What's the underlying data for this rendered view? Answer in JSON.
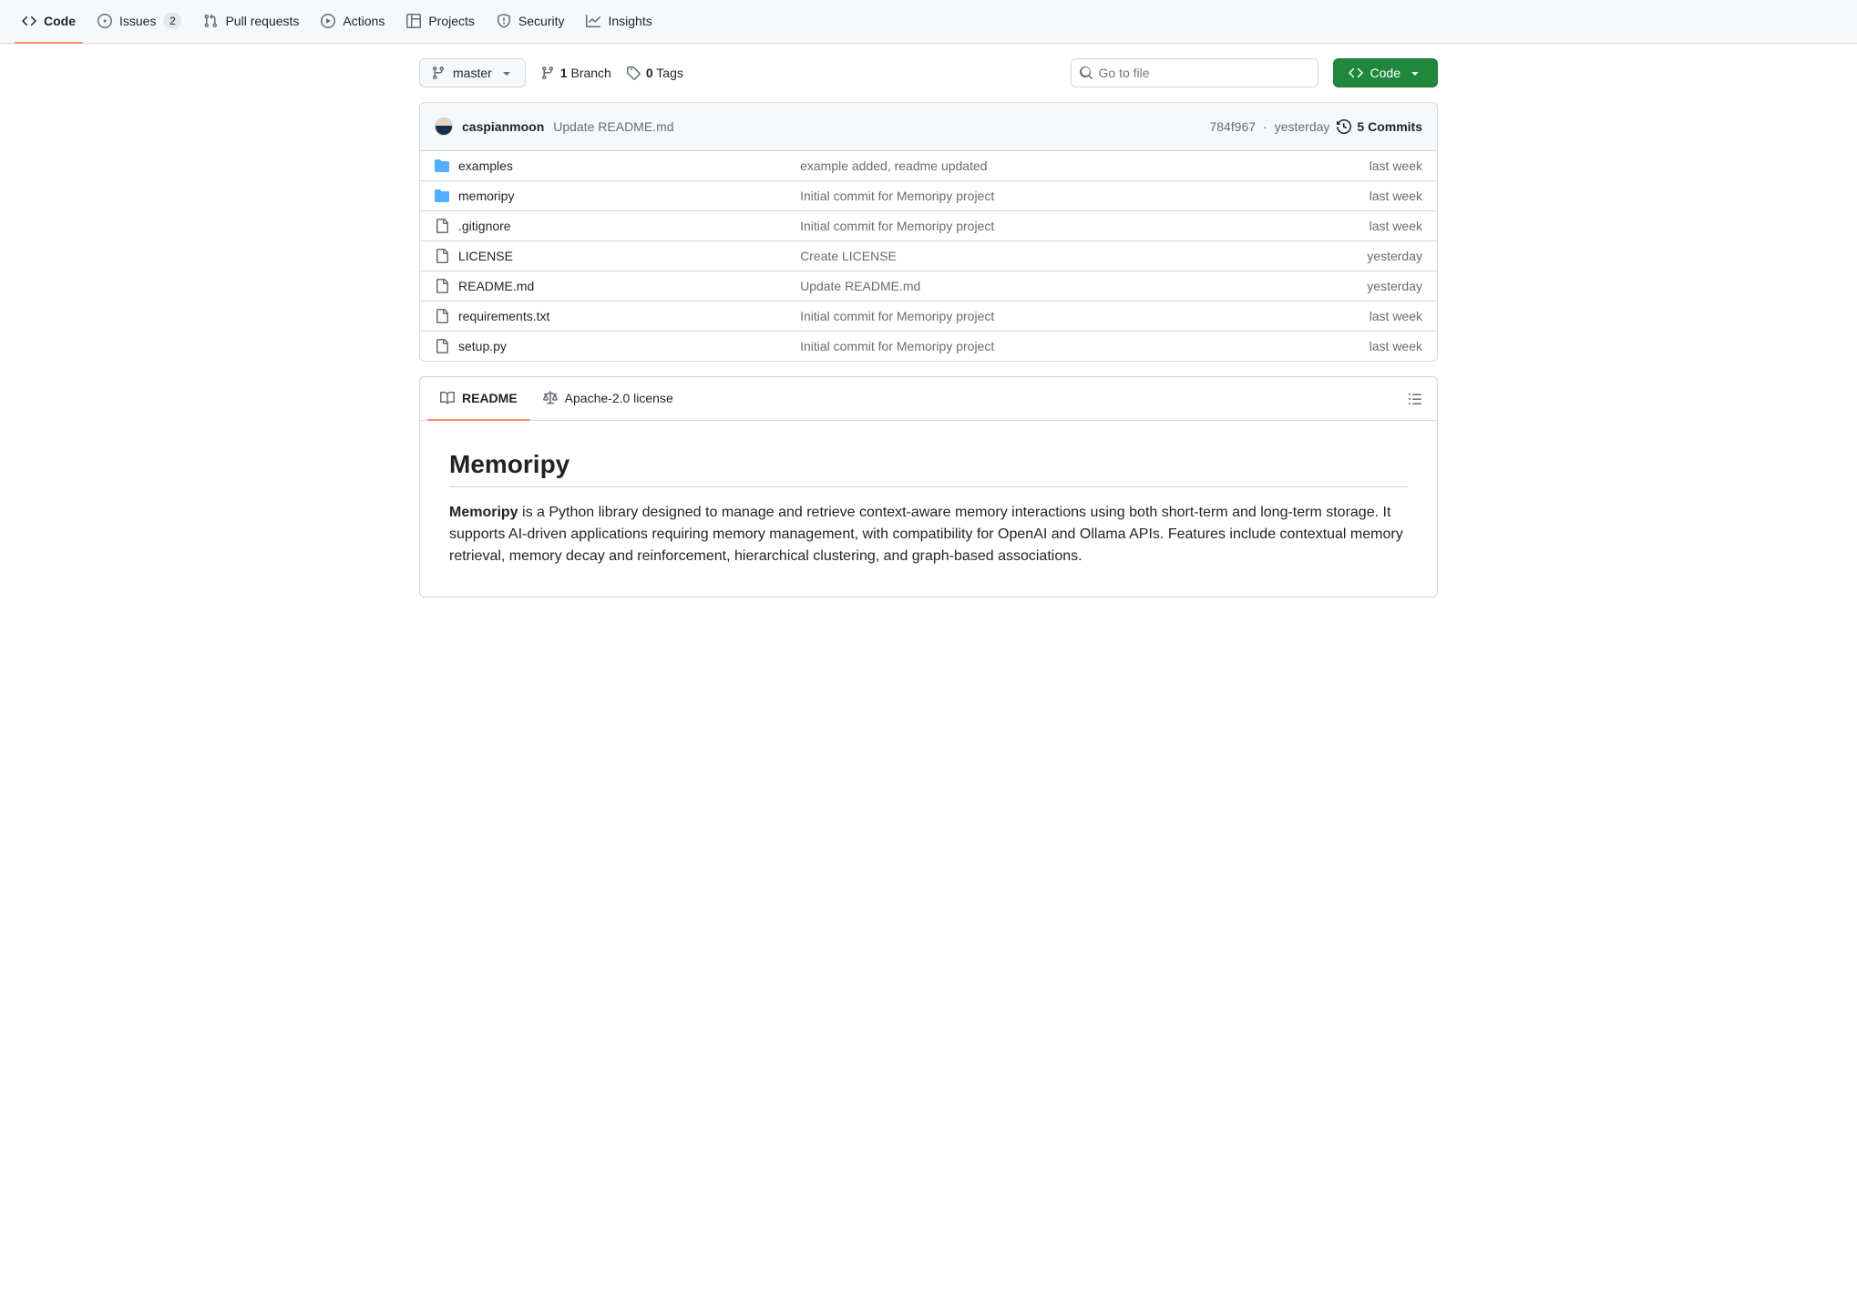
{
  "nav": {
    "code": "Code",
    "issues": "Issues",
    "issues_count": "2",
    "pulls": "Pull requests",
    "actions": "Actions",
    "projects": "Projects",
    "security": "Security",
    "insights": "Insights"
  },
  "toolbar": {
    "branch": "master",
    "branch_count": "1",
    "branch_label": "Branch",
    "tags_count": "0",
    "tags_label": "Tags",
    "search_placeholder": "Go to file",
    "code_label": "Code"
  },
  "commit": {
    "author": "caspianmoon",
    "message": "Update README.md",
    "sha": "784f967",
    "sep": "·",
    "when": "yesterday",
    "commits_count": "5 Commits"
  },
  "files": [
    {
      "type": "dir",
      "name": "examples",
      "msg": "example added, readme updated",
      "when": "last week"
    },
    {
      "type": "dir",
      "name": "memoripy",
      "msg": "Initial commit for Memoripy project",
      "when": "last week"
    },
    {
      "type": "file",
      "name": ".gitignore",
      "msg": "Initial commit for Memoripy project",
      "when": "last week"
    },
    {
      "type": "file",
      "name": "LICENSE",
      "msg": "Create LICENSE",
      "when": "yesterday"
    },
    {
      "type": "file",
      "name": "README.md",
      "msg": "Update README.md",
      "when": "yesterday"
    },
    {
      "type": "file",
      "name": "requirements.txt",
      "msg": "Initial commit for Memoripy project",
      "when": "last week"
    },
    {
      "type": "file",
      "name": "setup.py",
      "msg": "Initial commit for Memoripy project",
      "when": "last week"
    }
  ],
  "readme": {
    "tab_readme": "README",
    "tab_license": "Apache-2.0 license",
    "title": "Memoripy",
    "body_strong": "Memoripy",
    "body": " is a Python library designed to manage and retrieve context-aware memory interactions using both short-term and long-term storage. It supports AI-driven applications requiring memory management, with compatibility for OpenAI and Ollama APIs. Features include contextual memory retrieval, memory decay and reinforcement, hierarchical clustering, and graph-based associations."
  }
}
